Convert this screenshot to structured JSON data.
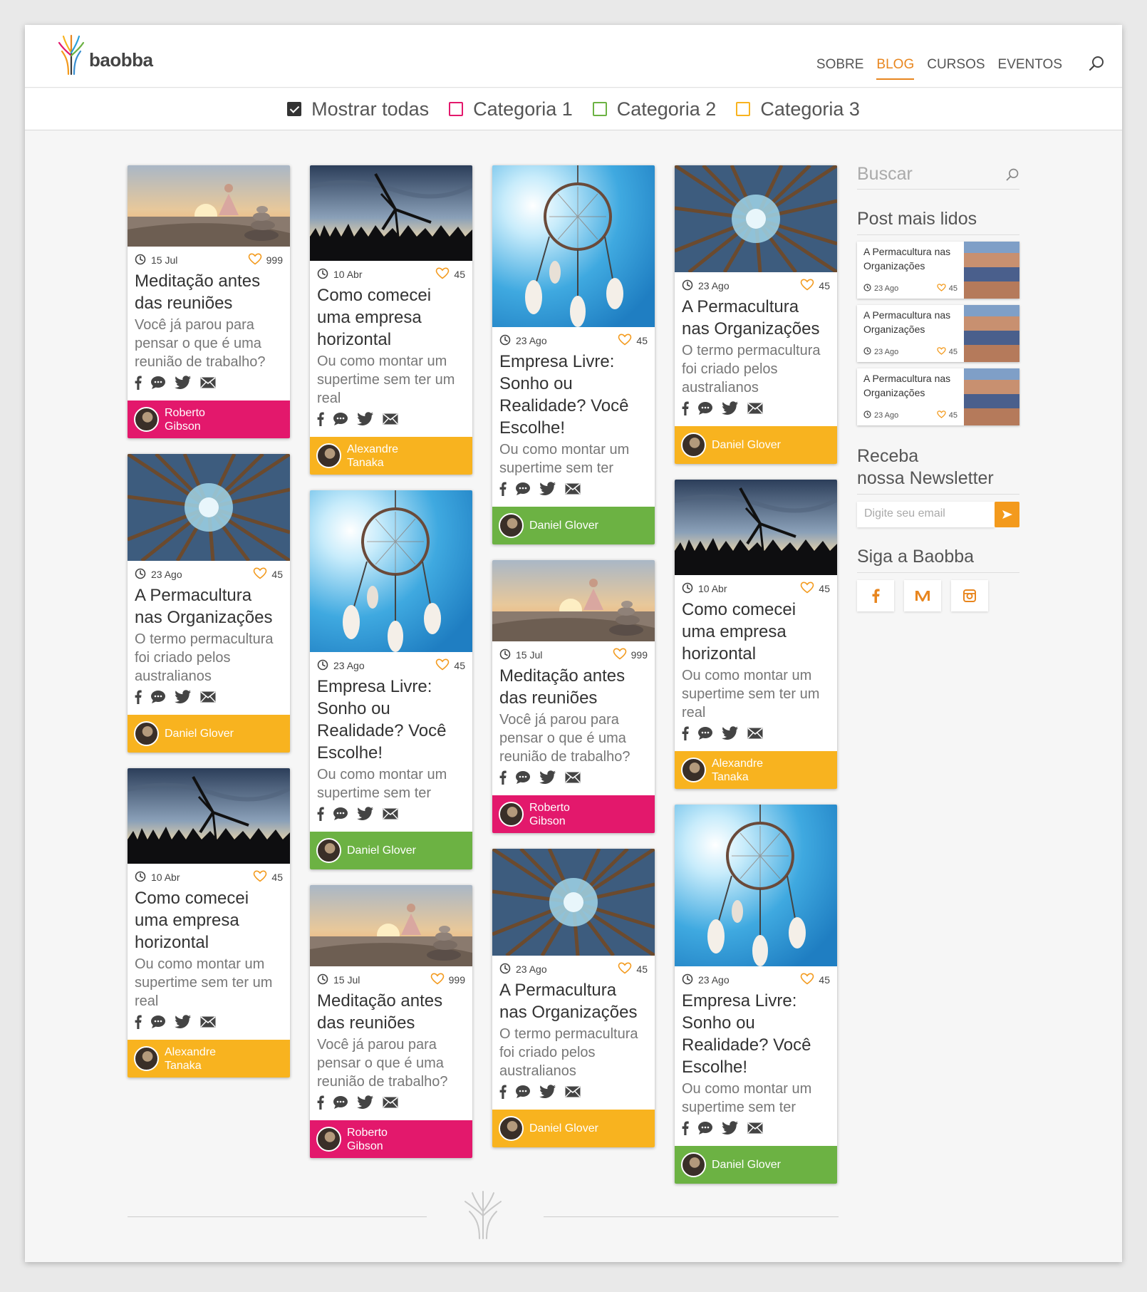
{
  "brand": {
    "name": "baobba",
    "accent": "#e8861f"
  },
  "nav": [
    {
      "label": "SOBRE",
      "active": false
    },
    {
      "label": "BLOG",
      "active": true
    },
    {
      "label": "CURSOS",
      "active": false
    },
    {
      "label": "EVENTOS",
      "active": false
    }
  ],
  "filters": [
    {
      "label": "Mostrar todas",
      "checked": true,
      "color": "#333333"
    },
    {
      "label": "Categoria 1",
      "checked": false,
      "color": "#e3186c"
    },
    {
      "label": "Categoria 2",
      "checked": false,
      "color": "#6cb243"
    },
    {
      "label": "Categoria 3",
      "checked": false,
      "color": "#f8b31f"
    }
  ],
  "columns": [
    [
      {
        "image": "sunset",
        "date": "15 Jul",
        "likes": "999",
        "title": "Meditação antes das reuniões",
        "excerpt": "Você já parou para pensar o que é uma reunião de trabalho?",
        "author": "Roberto Gibson",
        "color": "pink"
      },
      {
        "image": "trees",
        "date": "23 Ago",
        "likes": "45",
        "title": "A Permacultura nas Organizações",
        "excerpt": "O termo permacultura foi criado pelos australianos",
        "author": "Daniel Glover",
        "color": "orange"
      },
      {
        "image": "wind",
        "date": "10 Abr",
        "likes": "45",
        "title": "Como comecei uma empresa horizontal",
        "excerpt": "Ou como montar um supertime sem ter um real",
        "author": "Alexandre Tanaka",
        "color": "orange"
      }
    ],
    [
      {
        "image": "wind",
        "date": "10 Abr",
        "likes": "45",
        "title": "Como comecei uma empresa horizontal",
        "excerpt": "Ou como montar um supertime sem ter um real",
        "author": "Alexandre Tanaka",
        "color": "orange"
      },
      {
        "image": "catcher",
        "date": "23 Ago",
        "likes": "45",
        "title": "Empresa Livre: Sonho ou Realidade? Você Escolhe!",
        "excerpt": "Ou como montar um supertime sem ter",
        "author": "Daniel Glover",
        "color": "green"
      },
      {
        "image": "sunset",
        "date": "15 Jul",
        "likes": "999",
        "title": "Meditação antes das reuniões",
        "excerpt": "Você já parou para pensar o que é uma reunião de trabalho?",
        "author": "Roberto Gibson",
        "color": "pink"
      }
    ],
    [
      {
        "image": "catcher",
        "date": "23 Ago",
        "likes": "45",
        "title": "Empresa Livre: Sonho ou Realidade? Você Escolhe!",
        "excerpt": "Ou como montar um supertime sem ter",
        "author": "Daniel Glover",
        "color": "green"
      },
      {
        "image": "sunset",
        "date": "15 Jul",
        "likes": "999",
        "title": "Meditação antes das reuniões",
        "excerpt": "Você já parou para pensar o que é uma reunião de trabalho?",
        "author": "Roberto Gibson",
        "color": "pink"
      },
      {
        "image": "trees",
        "date": "23 Ago",
        "likes": "45",
        "title": "A Permacultura nas Organizações",
        "excerpt": "O termo permacultura foi criado pelos australianos",
        "author": "Daniel Glover",
        "color": "orange"
      }
    ],
    [
      {
        "image": "trees",
        "date": "23 Ago",
        "likes": "45",
        "title": "A Permacultura nas Organizações",
        "excerpt": "O termo permacultura foi criado pelos australianos",
        "author": "Daniel Glover",
        "color": "orange"
      },
      {
        "image": "wind",
        "date": "10 Abr",
        "likes": "45",
        "title": "Como comecei uma empresa horizontal",
        "excerpt": "Ou como montar um supertime sem ter um real",
        "author": "Alexandre Tanaka",
        "color": "orange"
      },
      {
        "image": "catcher",
        "date": "23 Ago",
        "likes": "45",
        "title": "Empresa Livre: Sonho ou Realidade? Você Escolhe!",
        "excerpt": "Ou como montar um supertime sem ter",
        "author": "Daniel Glover",
        "color": "green"
      }
    ]
  ],
  "sidebar": {
    "search_placeholder": "Buscar",
    "popular_heading": "Post mais lidos",
    "popular": [
      {
        "title": "A Permacultura nas Organizações",
        "date": "23 Ago",
        "likes": "45"
      },
      {
        "title": "A Permacultura nas Organizações",
        "date": "23 Ago",
        "likes": "45"
      },
      {
        "title": "A Permacultura nas Organizações",
        "date": "23 Ago",
        "likes": "45"
      }
    ],
    "newsletter_heading_1": "Receba",
    "newsletter_heading_2": "nossa Newsletter",
    "newsletter_placeholder": "Digite seu email",
    "follow_heading": "Siga a Baobba",
    "follow_icons": [
      "facebook-icon",
      "medium-icon",
      "instagram-icon"
    ]
  },
  "colors": {
    "pink": "#e3186c",
    "orange": "#f8b31f",
    "green": "#6cb243",
    "accent": "#e8861f"
  }
}
